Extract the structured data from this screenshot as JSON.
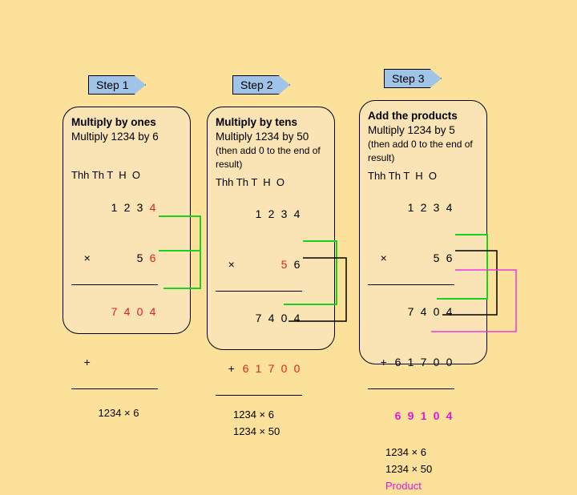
{
  "bg": "#fce19a",
  "steps": [
    {
      "tag": "Step 1",
      "title": "Multiply by ones",
      "subtitle": "Multiply 1234 by 6",
      "note": "",
      "headers": "Thh Th T  H  O",
      "rows": {
        "top": {
          "d": [
            "",
            "1",
            "2",
            "3",
            "4"
          ],
          "hi": [
            4
          ]
        },
        "mult": {
          "d": [
            "",
            "",
            "",
            "5",
            "6"
          ],
          "hi": [
            4
          ]
        },
        "p1": {
          "d": [
            "",
            "7",
            "4",
            "0",
            "4"
          ],
          "hi": [
            0,
            1,
            2,
            3,
            4
          ],
          "allred": true
        },
        "p2": {
          "d": [
            "",
            "",
            "",
            "",
            ""
          ]
        }
      },
      "below": [
        "1234 × 6"
      ]
    },
    {
      "tag": "Step 2",
      "title": "Multiply by tens",
      "subtitle": "Multiply 1234 by 50",
      "note": "(then add 0 to the end of result)",
      "headers": "Thh Th T  H  O",
      "rows": {
        "top": {
          "d": [
            "",
            "1",
            "2",
            "3",
            "4"
          ]
        },
        "mult": {
          "d": [
            "",
            "",
            "",
            "5",
            "6"
          ],
          "hi": [
            3
          ]
        },
        "p1": {
          "d": [
            "",
            "7",
            "4",
            "0",
            "4"
          ]
        },
        "p2": {
          "d": [
            "6",
            "1",
            "7",
            "0",
            "0"
          ],
          "allred": true
        }
      },
      "below": [
        "1234 × 6",
        "1234 × 50"
      ]
    },
    {
      "tag": "Step 3",
      "title": "Add the products",
      "subtitle": "Multiply 1234 by 5",
      "note": "(then add 0 to the end of result)",
      "headers": "Thh Th T  H  O",
      "rows": {
        "top": {
          "d": [
            "",
            "1",
            "2",
            "3",
            "4"
          ]
        },
        "mult": {
          "d": [
            "",
            "",
            "",
            "5",
            "6"
          ]
        },
        "p1": {
          "d": [
            "",
            "7",
            "4",
            "0",
            "4"
          ]
        },
        "p2": {
          "d": [
            "6",
            "1",
            "7",
            "0",
            "0"
          ]
        },
        "sum": {
          "d": [
            "6",
            "9",
            "1",
            "0",
            "4"
          ],
          "mag": true
        }
      },
      "below": [
        "1234 × 6",
        "1234 × 50",
        "Product"
      ]
    }
  ]
}
